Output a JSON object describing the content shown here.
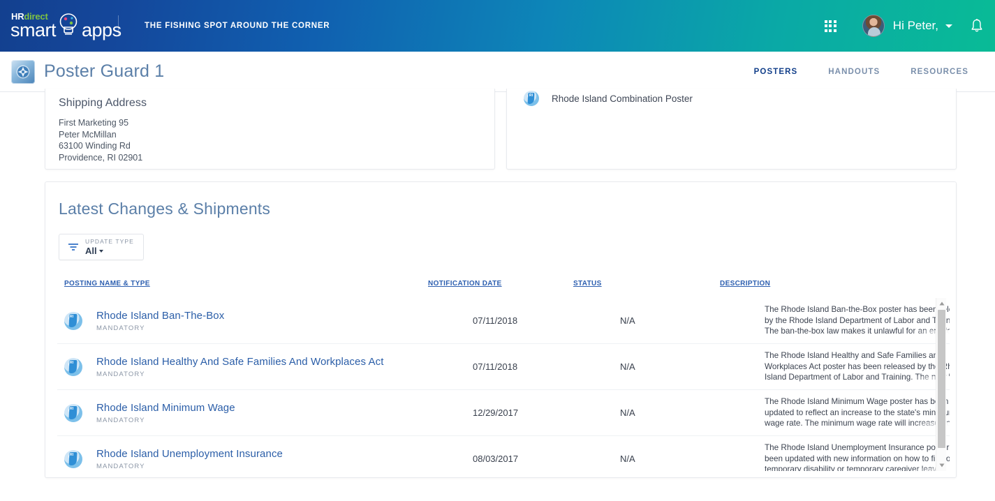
{
  "topbar": {
    "logo_hr": "HR",
    "logo_direct": "direct",
    "logo_smart": "smart",
    "logo_apps": "apps",
    "tagline": "THE FISHING SPOT AROUND THE CORNER",
    "greeting": "Hi Peter,",
    "apps_icon": "grid-apps-icon",
    "bell_icon": "notification-bell-icon",
    "avatar_alt": "user-avatar",
    "gradient_start": "#13408f",
    "gradient_end": "#09bb96"
  },
  "subheader": {
    "app_title": "Poster Guard 1",
    "app_icon": "poster-guard-compass-icon",
    "tabs": [
      {
        "label": "POSTERS",
        "active": true
      },
      {
        "label": "HANDOUTS",
        "active": false
      },
      {
        "label": "RESOURCES",
        "active": false
      }
    ],
    "active_accent": "#1a53b0"
  },
  "shipping_card": {
    "title": "Shipping Address",
    "lines": [
      "First Marketing 95",
      "Peter McMillan",
      "63100 Winding Rd",
      "Providence, RI 02901"
    ]
  },
  "poster_card": {
    "item_label": "Rhode Island Combination Poster",
    "item_icon": "ri-poster-icon"
  },
  "latest": {
    "title": "Latest Changes & Shipments",
    "filter": {
      "icon": "filter-icon",
      "label": "UPDATE TYPE",
      "value": "All"
    },
    "columns": [
      "POSTING NAME & TYPE",
      "NOTIFICATION DATE",
      "STATUS",
      "DESCRIPTION"
    ],
    "rows": [
      {
        "icon": "ri-poster-icon",
        "name": "Rhode Island Ban-The-Box",
        "type": "MANDATORY",
        "date": "07/11/2018",
        "status": "N/A",
        "description": "The Rhode Island Ban-the-Box poster has been released by the Rhode Island Department of Labor and Training. The ban-the-box law makes it unlawful for an employer",
        "chevron": "chevron-right-icon"
      },
      {
        "icon": "ri-poster-icon",
        "name": "Rhode Island Healthy And Safe Families And Workplaces Act",
        "type": "MANDATORY",
        "date": "07/11/2018",
        "status": "N/A",
        "description": "The Rhode Island Healthy and Safe Families and Workplaces Act poster has been released by the Rhode Island Department of Labor and Training. The new law",
        "chevron": "chevron-right-icon"
      },
      {
        "icon": "ri-poster-icon",
        "name": "Rhode Island Minimum Wage",
        "type": "MANDATORY",
        "date": "12/29/2017",
        "status": "N/A",
        "description": "The Rhode Island Minimum Wage poster has been updated to reflect an increase to the state's minimum wage rate. The minimum wage rate will increase from",
        "chevron": "chevron-right-icon"
      },
      {
        "icon": "ri-poster-icon",
        "name": "Rhode Island Unemployment Insurance",
        "type": "MANDATORY",
        "date": "08/03/2017",
        "status": "N/A",
        "description": "The Rhode Island Unemployment Insurance poster has been updated with new information on how to file for temporary disability or temporary caregiver leave",
        "chevron": "chevron-right-icon"
      }
    ],
    "scrollbar": {
      "up_icon": "scroll-up-arrow-icon",
      "down_icon": "scroll-down-arrow-icon"
    }
  }
}
